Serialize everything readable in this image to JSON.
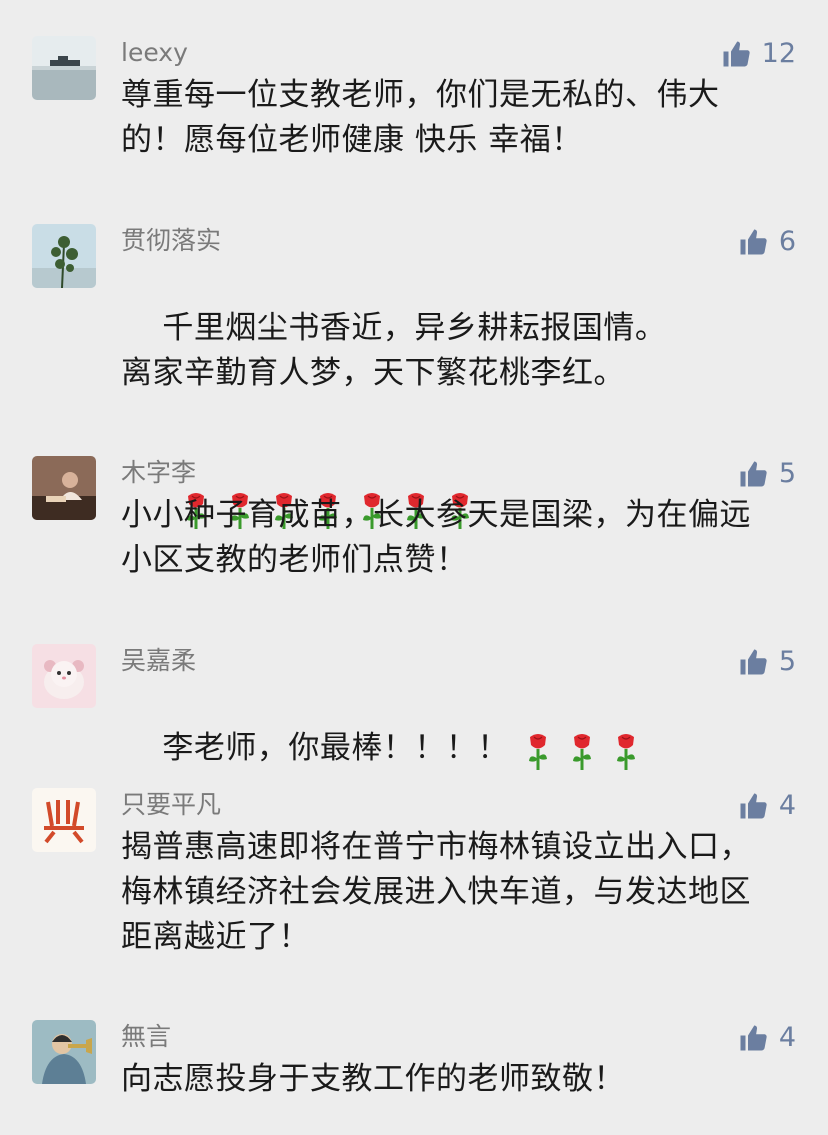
{
  "comments": [
    {
      "nickname": "leexy",
      "likes": "12",
      "avatar": "ship-on-sea-avatar",
      "text": "尊重每一位支教老师，你们是无私的、伟大\n的！愿每位老师健康 快乐 幸福！",
      "roses": 0
    },
    {
      "nickname": "贯彻落实",
      "likes": "6",
      "avatar": "plant-silhouette-avatar",
      "text": "千里烟尘书香近，异乡耕耘报国情。\n离家辛勤育人梦，天下繁花桃李红。",
      "roses": 7
    },
    {
      "nickname": "木字李",
      "likes": "5",
      "avatar": "person-reading-avatar",
      "text": "小小种子育成苗，长大参天是国梁，为在偏远\n小区支教的老师们点赞！",
      "roses": 0
    },
    {
      "nickname": "吴嘉柔",
      "likes": "5",
      "avatar": "hamster-cartoon-avatar",
      "text": "李老师，你最棒！！！！",
      "roses": 3
    },
    {
      "nickname": "只要平凡",
      "likes": "4",
      "avatar": "calligraphy-character-avatar",
      "text": "揭普惠高速即将在普宁市梅林镇设立出入口，\n梅林镇经济社会发展进入快车道，与发达地区\n距离越近了！",
      "roses": 0
    },
    {
      "nickname": "無言",
      "likes": "4",
      "avatar": "person-with-trumpet-avatar",
      "text": "向志愿投身于支教工作的老师致敬！",
      "roses": 0
    }
  ],
  "colors": {
    "background": "#ededed",
    "nickname": "#7a7a7a",
    "like_count": "#6b7ea0",
    "like_icon": "#6b7ea0",
    "body_text": "#1a1a1a",
    "rose_red": "#e0282e",
    "rose_green": "#3a9a2c"
  },
  "icons": {
    "like": "thumbs-up-icon",
    "rose": "rose-emoji"
  }
}
